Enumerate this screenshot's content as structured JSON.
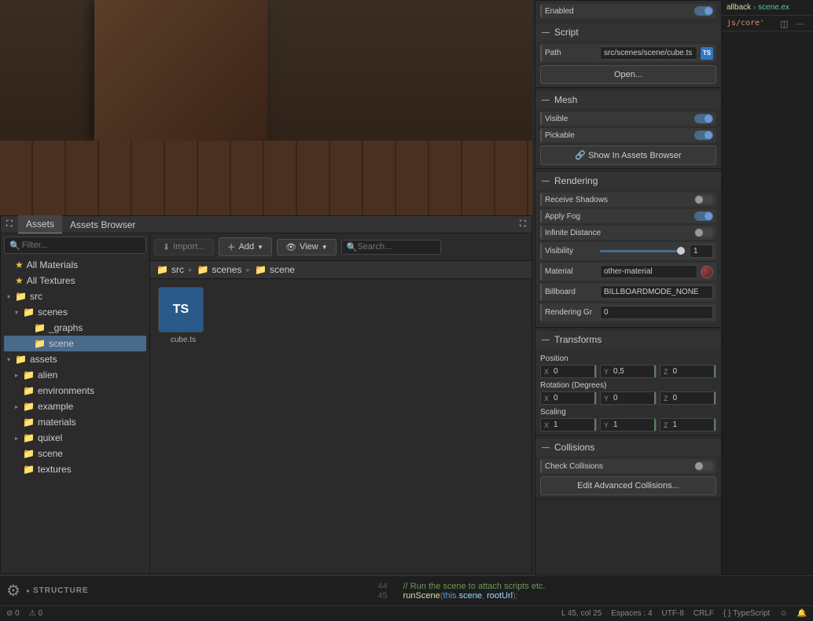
{
  "tabs": {
    "assets": "Assets",
    "browser": "Assets Browser"
  },
  "filter": {
    "placeholder": "Filter..."
  },
  "tree": {
    "all_materials": "All Materials",
    "all_textures": "All Textures",
    "src": "src",
    "scenes": "scenes",
    "_graphs": "_graphs",
    "scene": "scene",
    "assets": "assets",
    "alien": "alien",
    "environments": "environments",
    "example": "example",
    "materials": "materials",
    "quixel": "quixel",
    "scene2": "scene",
    "textures": "textures"
  },
  "toolbar": {
    "import": "Import...",
    "add": "Add",
    "view": "View"
  },
  "search": {
    "placeholder": "Search..."
  },
  "breadcrumb": {
    "src": "src",
    "scenes": "scenes",
    "scene": "scene"
  },
  "asset": {
    "cube": "cube.ts",
    "ts": "TS"
  },
  "inspector": {
    "enabled": "Enabled",
    "script_section": "Script",
    "path": "Path",
    "path_value": "src/scenes/scene/cube.ts",
    "open": "Open...",
    "mesh_section": "Mesh",
    "visible": "Visible",
    "pickable": "Pickable",
    "show_assets": "Show In Assets Browser",
    "rendering_section": "Rendering",
    "receive_shadows": "Receive Shadows",
    "apply_fog": "Apply Fog",
    "infinite_distance": "Infinite Distance",
    "visibility": "Visibility",
    "visibility_val": "1",
    "material": "Material",
    "material_val": "other-material",
    "billboard": "Billboard",
    "billboard_val": "BILLBOARDMODE_NONE",
    "rendering_gr": "Rendering Gr",
    "rendering_gr_val": "0",
    "transforms_section": "Transforms",
    "position": "Position",
    "rotation": "Rotation (Degrees)",
    "scaling": "Scaling",
    "pos": {
      "x": "0",
      "y": "0,5",
      "z": "0"
    },
    "rot": {
      "x": "0",
      "y": "0",
      "z": "0"
    },
    "scale": {
      "x": "1",
      "y": "1",
      "z": "1"
    },
    "collisions_section": "Collisions",
    "check_collisions": "Check Collisions",
    "edit_collisions": "Edit Advanced Collisions..."
  },
  "code": {
    "breadcrumb_fn": "allback",
    "breadcrumb_file": "scene.ex",
    "snippet2": "js/core'",
    "line44": "44",
    "line45": "45",
    "comment": "// Run the scene to attach scripts etc.",
    "code_line": "runScene(this.scene, rootUrl);"
  },
  "structure": "STRUCTURE",
  "status": {
    "errors": "0",
    "warnings": "0",
    "position": "L 45, col 25",
    "spaces": "Espaces : 4",
    "encoding": "UTF-8",
    "eol": "CRLF",
    "lang": "TypeScript"
  }
}
